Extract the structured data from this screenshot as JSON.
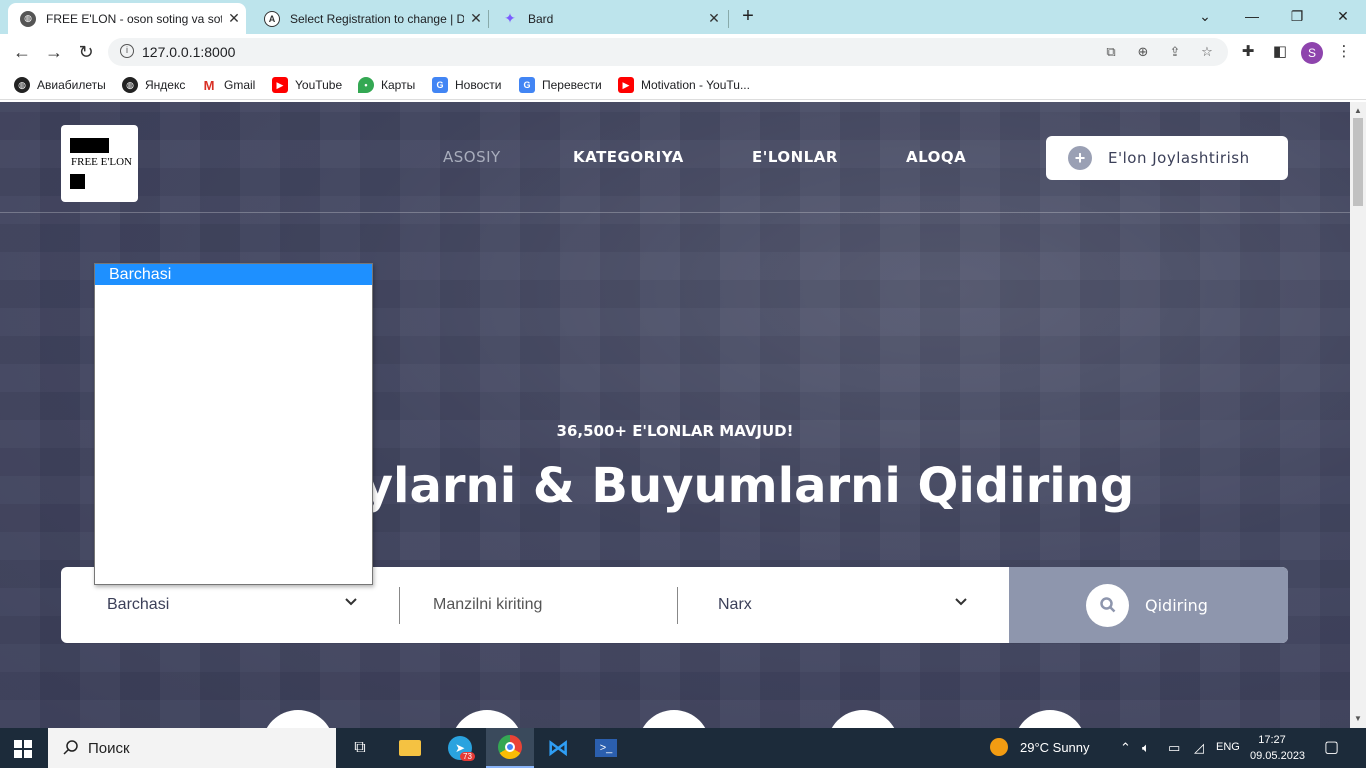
{
  "browser": {
    "tabs": [
      {
        "title": "FREE E'LON - oson soting va sotib",
        "active": true
      },
      {
        "title": "Select Registration to change | Dj",
        "active": false
      },
      {
        "title": "Bard",
        "active": false
      }
    ],
    "url": "127.0.0.1:8000",
    "profile_initial": "S",
    "bookmarks": [
      "Авиабилеты",
      "Яндекс",
      "Gmail",
      "YouTube",
      "Карты",
      "Новости",
      "Перевести",
      "Motivation - YouTu..."
    ]
  },
  "site": {
    "logo_text": "FREE E'LON",
    "nav": [
      "ASOSIY",
      "KATEGORIYA",
      "E'LONLAR",
      "ALOQA"
    ],
    "post_button": "E'lon Joylashtirish",
    "subtitle": "36,500+ E'LONLAR MAVJUD!",
    "headline": "n Joylarni & Buyumlarni Qidiring",
    "search": {
      "category_value": "Barchasi",
      "location_placeholder": "Manzilni kiriting",
      "price_value": "Narx",
      "button_label": "Qidiring"
    },
    "dropdown": {
      "options": [
        "Barchasi"
      ],
      "selected": "Barchasi"
    }
  },
  "taskbar": {
    "search_placeholder": "Поиск",
    "weather": "29°C  Sunny",
    "telegram_badge": "73",
    "language": "ENG",
    "time": "17:27",
    "date": "09.05.2023"
  }
}
